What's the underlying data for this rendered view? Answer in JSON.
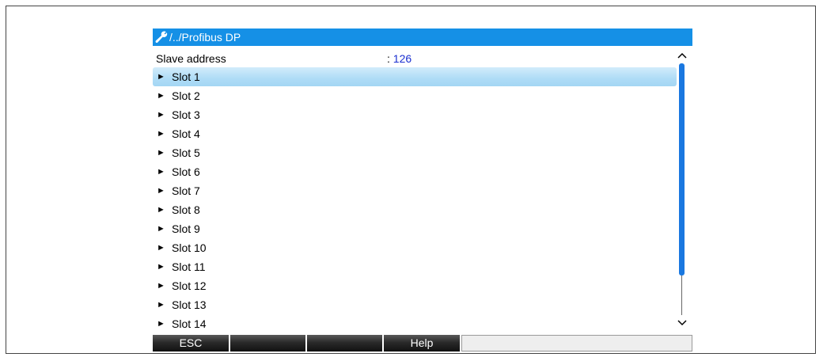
{
  "title": {
    "icon": "wrench-icon",
    "path": "/../Profibus DP"
  },
  "header": {
    "label": "Slave address",
    "separator": ": ",
    "value": "126"
  },
  "menu": {
    "arrow": "►",
    "items": [
      {
        "label": "Slot 1",
        "selected": true
      },
      {
        "label": "Slot 2"
      },
      {
        "label": "Slot 3"
      },
      {
        "label": "Slot 4"
      },
      {
        "label": "Slot 5"
      },
      {
        "label": "Slot 6"
      },
      {
        "label": "Slot 7"
      },
      {
        "label": "Slot 8"
      },
      {
        "label": "Slot 9"
      },
      {
        "label": "Slot 10"
      },
      {
        "label": "Slot 11"
      },
      {
        "label": "Slot 12"
      },
      {
        "label": "Slot 13"
      },
      {
        "label": "Slot 14"
      }
    ]
  },
  "softkeys": {
    "esc": "ESC",
    "key2": "",
    "key3": "",
    "help": "Help"
  },
  "colors": {
    "title_bar": "#1590e6",
    "value_text": "#1a2fd0",
    "selection": "#aedcf6",
    "scroll_thumb": "#1a78e0"
  }
}
